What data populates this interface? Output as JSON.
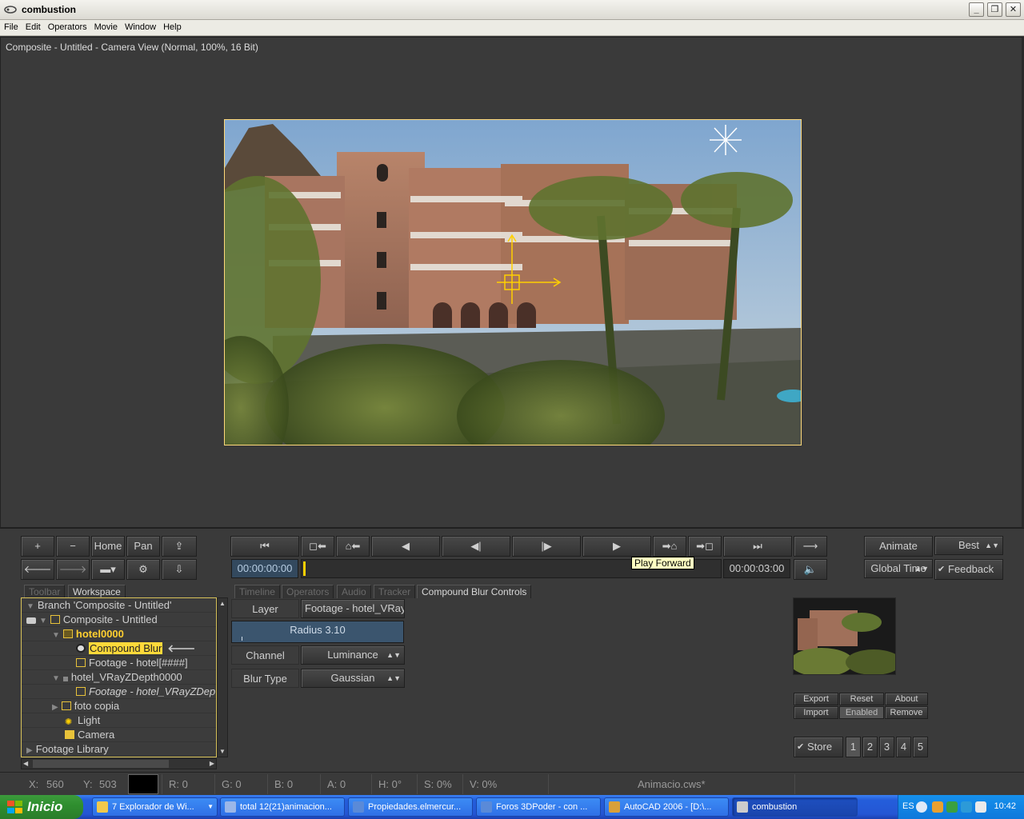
{
  "window": {
    "title": "combustion"
  },
  "menu": [
    "File",
    "Edit",
    "Operators",
    "Movie",
    "Window",
    "Help"
  ],
  "viewer": {
    "title": "Composite - Untitled - Camera View (Normal, 100%, 16 Bit)"
  },
  "nav_buttons": {
    "plus": "+",
    "minus": "−",
    "home": "Home",
    "pan": "Pan"
  },
  "transport": {
    "current_time": "00:00:00:00",
    "end_time": "00:00:03:00",
    "tooltip": "Play Forward"
  },
  "right_controls": {
    "animate": "Animate",
    "quality": "Best",
    "time_mode": "Global Time",
    "feedback": "Feedback"
  },
  "tabs": {
    "left": [
      "Toolbar",
      "Workspace"
    ],
    "right": [
      "Timeline",
      "Operators",
      "Audio",
      "Tracker",
      "Compound Blur Controls"
    ]
  },
  "tree": [
    {
      "label": "Branch 'Composite - Untitled'",
      "indent": 0,
      "style": "normal"
    },
    {
      "label": "Composite - Untitled",
      "indent": 1,
      "style": "normal"
    },
    {
      "label": "hotel0000",
      "indent": 2,
      "style": "bold"
    },
    {
      "label": "Compound Blur",
      "indent": 3,
      "style": "selected"
    },
    {
      "label": "Footage - hotel[####]",
      "indent": 3,
      "style": "normal"
    },
    {
      "label": "hotel_VRayZDepth0000",
      "indent": 2,
      "style": "normal"
    },
    {
      "label": "Footage - hotel_VRayZDep",
      "indent": 3,
      "style": "italic"
    },
    {
      "label": "foto copia",
      "indent": 2,
      "style": "normal"
    },
    {
      "label": "Light",
      "indent": 2,
      "style": "normal"
    },
    {
      "label": "Camera",
      "indent": 2,
      "style": "normal"
    },
    {
      "label": "Footage Library",
      "indent": 0,
      "style": "normal"
    }
  ],
  "controls": {
    "layer_label": "Layer",
    "layer_value": "Footage - hotel_VRay",
    "radius_label": "Radius 3.10",
    "radius": 3.1,
    "channel_label": "Channel",
    "channel_value": "Luminance",
    "blur_type_label": "Blur Type",
    "blur_type_value": "Gaussian"
  },
  "operator_buttons": {
    "export": "Export",
    "reset": "Reset",
    "about": "About",
    "import": "Import",
    "enabled": "Enabled",
    "remove": "Remove",
    "store": "Store",
    "slots": [
      "1",
      "2",
      "3",
      "4",
      "5"
    ]
  },
  "status": {
    "x_label": "X:",
    "x": "560",
    "y_label": "Y:",
    "y": "503",
    "r": "R: 0",
    "g": "G: 0",
    "b": "B: 0",
    "a": "A: 0",
    "h": "H: 0°",
    "s": "S: 0%",
    "v": "V: 0%",
    "file": "Animacio.cws*"
  },
  "taskbar": {
    "start": "Inicio",
    "tasks": [
      "7 Explorador de Wi...",
      "total 12(21)animacion...",
      "Propiedades.elmercur...",
      "Foros 3DPoder - con ...",
      "AutoCAD 2006 - [D:\\...",
      "combustion"
    ],
    "lang": "ES",
    "clock": "10:42"
  },
  "colors": {
    "accent_yellow": "#ffd93a",
    "frame_border": "#ffd97a",
    "slider_blue": "#3b556e"
  }
}
